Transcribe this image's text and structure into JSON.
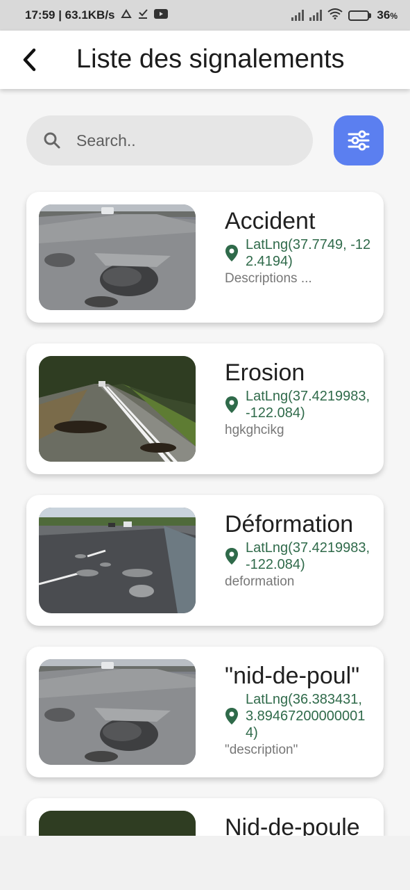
{
  "status_bar": {
    "time_speed": "17:59 | 63.1KB/s",
    "battery": "36",
    "battery_unit": "%"
  },
  "app_bar": {
    "title": "Liste des signalements",
    "back_icon": "chevron-left-icon"
  },
  "search": {
    "placeholder": "Search..",
    "icon": "search-icon",
    "filter_icon": "sliders-icon",
    "filter_color": "#5b7ff0"
  },
  "reports": [
    {
      "title": "Accident",
      "coords": "LatLng(37.7749, -122.4194)",
      "description": "Descriptions ..."
    },
    {
      "title": "Erosion",
      "coords": "LatLng(37.4219983, -122.084)",
      "description": "hgkghcikg"
    },
    {
      "title": "Déformation",
      "coords": "LatLng(37.4219983, -122.084)",
      "description": "deformation"
    },
    {
      "title": "\"nid-de-poul\"",
      "coords": "LatLng(36.383431, 3.894672000000014)",
      "description": "\"description\""
    },
    {
      "title": "Nid-de-poule",
      "coords": "",
      "description": ""
    }
  ],
  "colors": {
    "accent": "#5b7ff0",
    "coord_text": "#2f6a4a"
  }
}
